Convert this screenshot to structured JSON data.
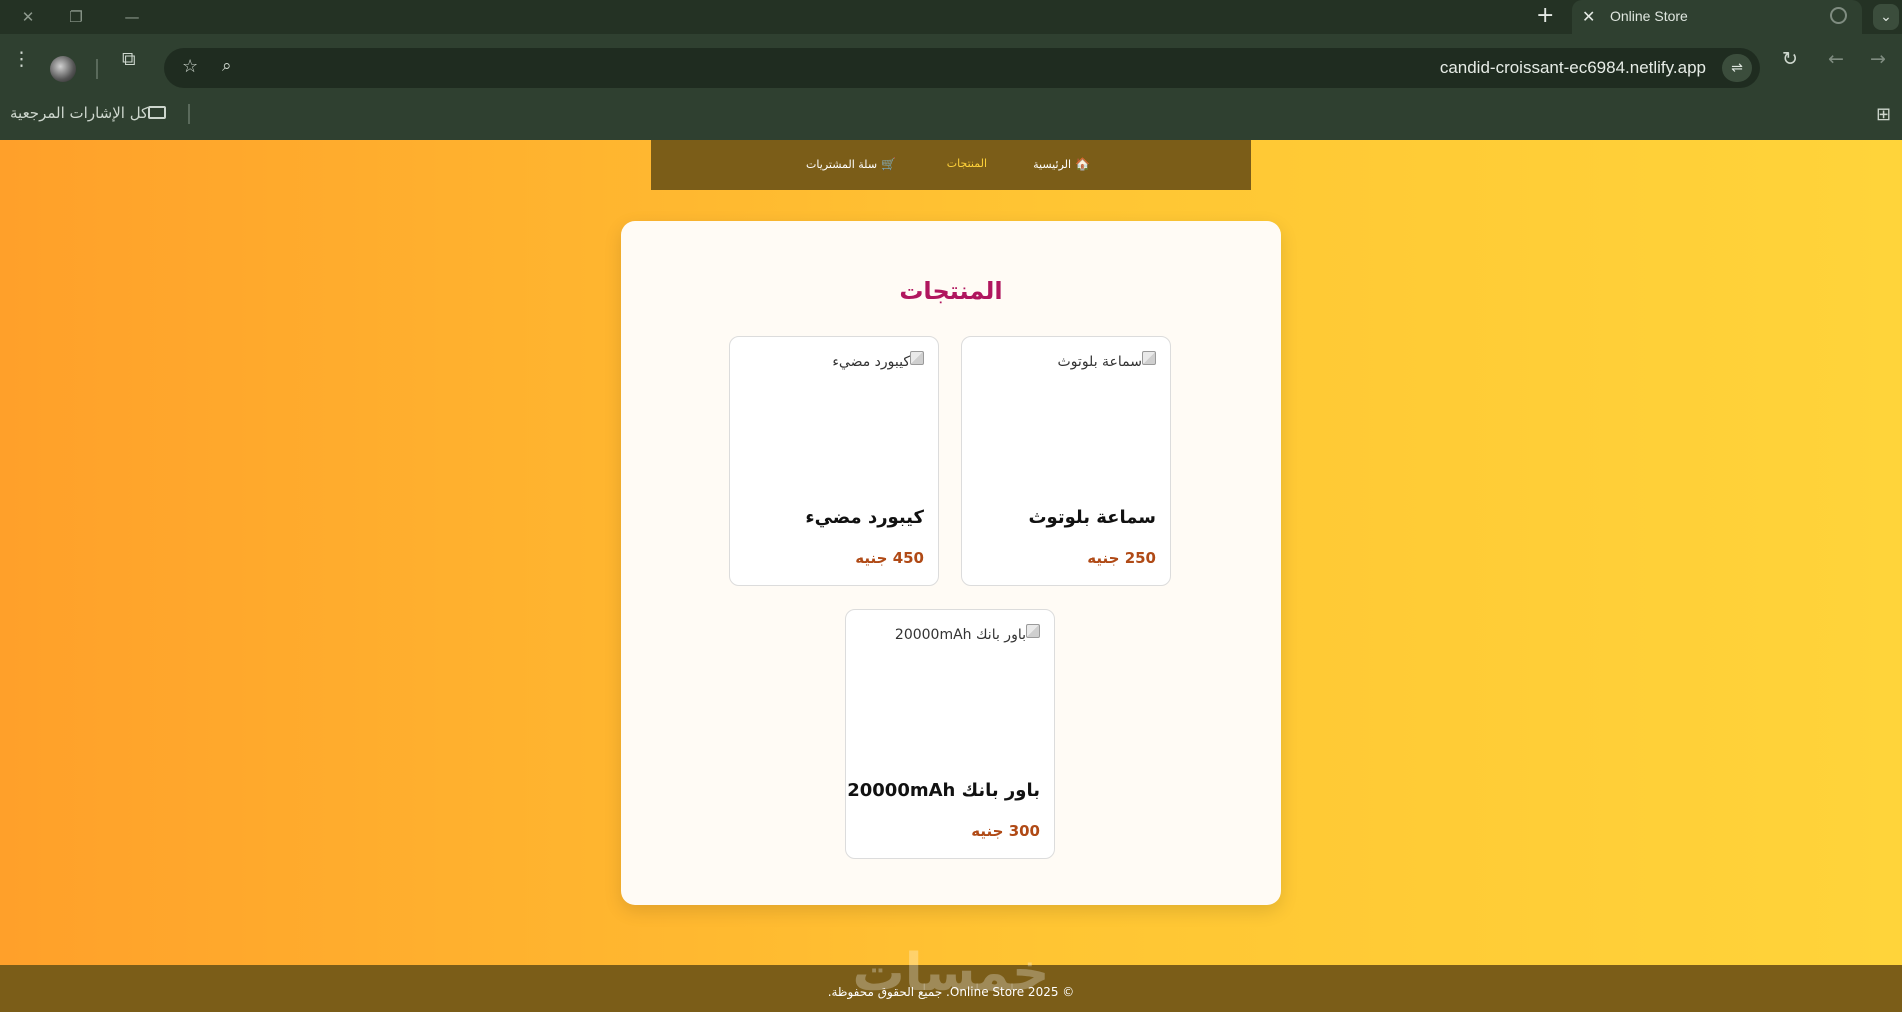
{
  "browser": {
    "tab_title": "Online Store",
    "url": "candid-croissant-ec6984.netlify.app",
    "bookmarks_label": "كل الإشارات المرجعية"
  },
  "nav": {
    "items": [
      {
        "label": "الرئيسية",
        "icon": "home-icon"
      },
      {
        "label": "المنتجات",
        "active": true
      },
      {
        "label": "سلة المشتريات",
        "icon": "cart-icon"
      }
    ]
  },
  "main": {
    "title": "المنتجات",
    "products": [
      {
        "image_alt": "سماعة بلوتوث",
        "name": "سماعة بلوتوث",
        "price": "250 جنيه"
      },
      {
        "image_alt": "كيبورد مضيء",
        "name": "كيبورد مضيء",
        "price": "450 جنيه"
      },
      {
        "image_alt": "باور بانك 20000mAh",
        "name": "باور بانك 20000mAh",
        "price": "300 جنيه"
      }
    ]
  },
  "footer": {
    "text": "© Online Store 2025. جميع الحقوق محفوظة.",
    "watermark": "خمسات"
  },
  "colors": {
    "accent_title": "#b0165e",
    "price": "#b04a16",
    "nav_bg": "#7b5d18",
    "nav_active": "#ffd23a"
  }
}
